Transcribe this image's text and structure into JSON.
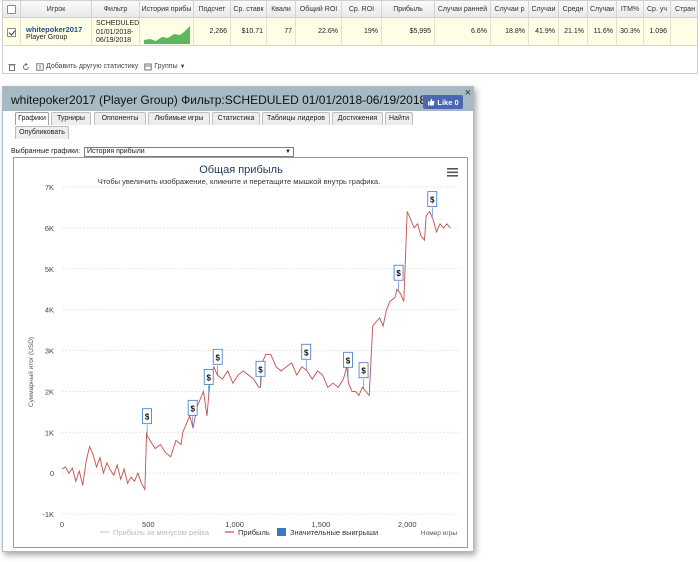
{
  "stats_grid": {
    "headers": [
      "Игрок",
      "Фильтр",
      "История прибы",
      "Подсчет",
      "Ср. ставк",
      "Квали",
      "Общий ROI",
      "Ср. ROI",
      "Прибыль",
      "Случаи ранней",
      "Случаи р",
      "Случаи",
      "Средн",
      "Случаи",
      "ITM%",
      "Ср. уч",
      "Стран"
    ],
    "row": {
      "player": "whitepoker2017",
      "group": "Player Group",
      "filter_line1": "SCHEDULED",
      "filter_line2": "01/01/2018-",
      "filter_line3": "06/19/2018",
      "count": "2,266",
      "avg_stake": "$10.71",
      "qual": "77",
      "total_roi": "22.6%",
      "avg_roi": "19%",
      "profit": "$5,995",
      "early_cases": "6.6%",
      "cases_r": "18.8%",
      "cases": "41.9%",
      "avg": "21.1%",
      "cases2": "11.6%",
      "itm": "30.3%",
      "avg_part": "1.096",
      "country": ""
    },
    "toolbar": {
      "add_stats": "Добавить другую статистику",
      "groups": "Группы"
    }
  },
  "dialog": {
    "title": "whitepoker2017 (Player Group) Фильтр:SCHEDULED 01/01/2018-06/19/2018",
    "like_label": "Like 0",
    "tabs": [
      "Графики",
      "Турниры",
      "Оппоненты",
      "Любимые игры",
      "Статистика",
      "Таблицы лидеров",
      "Достижения",
      "Найти",
      "Опубликовать"
    ],
    "selected_graph_label": "Выбранные графики:",
    "selected_graph_value": "История прибыли"
  },
  "chart_data": {
    "type": "line",
    "title": "Общая прибыль",
    "subtitle": "Чтобы увеличить изображение, кликните и перетащите мышкой внутрь графика.",
    "xlabel": "Номер игры",
    "ylabel": "Суммарный итог (USD)",
    "xlim": [
      0,
      2300
    ],
    "ylim": [
      -1000,
      7000
    ],
    "x_ticks": [
      "0",
      "500",
      "1,000",
      "1,500",
      "2,000"
    ],
    "y_ticks": [
      "-1K",
      "0",
      "1K",
      "2K",
      "3K",
      "4K",
      "5K",
      "6K",
      "7K"
    ],
    "grid": "horizontal dotted",
    "legend_position": "bottom-center",
    "legend": [
      "Прибыль за минусом рейка",
      "Прибыль",
      "Значительные выигрыши"
    ],
    "series": [
      {
        "name": "Прибыль",
        "color": "#c0504d",
        "x": [
          0,
          20,
          40,
          60,
          80,
          100,
          120,
          140,
          160,
          180,
          200,
          220,
          240,
          260,
          280,
          300,
          320,
          340,
          360,
          380,
          400,
          420,
          440,
          460,
          480,
          490,
          495,
          510,
          540,
          570,
          600,
          630,
          660,
          690,
          700,
          720,
          740,
          760,
          780,
          800,
          820,
          840,
          860,
          870,
          880,
          900,
          930,
          960,
          990,
          1020,
          1050,
          1080,
          1110,
          1140,
          1150,
          1160,
          1180,
          1210,
          1240,
          1270,
          1300,
          1330,
          1360,
          1390,
          1420,
          1450,
          1480,
          1510,
          1540,
          1570,
          1600,
          1630,
          1650,
          1660,
          1680,
          1700,
          1720,
          1740,
          1760,
          1780,
          1800,
          1820,
          1840,
          1860,
          1880,
          1900,
          1930,
          1940,
          1960,
          1980,
          2000,
          2020,
          2040,
          2060,
          2080,
          2100,
          2110,
          2130,
          2150,
          2170,
          2190,
          2210,
          2230,
          2250
        ],
        "y": [
          100,
          150,
          0,
          120,
          -200,
          50,
          -300,
          300,
          650,
          450,
          150,
          380,
          0,
          250,
          80,
          -50,
          200,
          -150,
          100,
          -250,
          -100,
          -200,
          0,
          -250,
          -400,
          1000,
          900,
          800,
          600,
          700,
          500,
          400,
          800,
          700,
          1000,
          1200,
          1400,
          1100,
          1600,
          1800,
          2000,
          1400,
          2400,
          2500,
          2600,
          2400,
          2300,
          2500,
          2200,
          2400,
          2500,
          2400,
          2300,
          2100,
          2100,
          2700,
          2900,
          2900,
          2600,
          2500,
          2600,
          2700,
          2400,
          2600,
          2500,
          2300,
          2500,
          2400,
          2100,
          2200,
          2100,
          2300,
          2600,
          2200,
          2000,
          2000,
          1900,
          2100,
          2000,
          1900,
          3600,
          3700,
          3800,
          3600,
          4000,
          4200,
          4300,
          4500,
          4400,
          4200,
          6400,
          6200,
          6000,
          6100,
          5800,
          5700,
          6300,
          6400,
          6200,
          5900,
          6100,
          6000,
          6100,
          5995
        ]
      }
    ],
    "big_wins": [
      493,
      757,
      850,
      902,
      1150,
      1415,
      1657,
      1747,
      1950,
      2145
    ],
    "big_win_marker": "$"
  }
}
